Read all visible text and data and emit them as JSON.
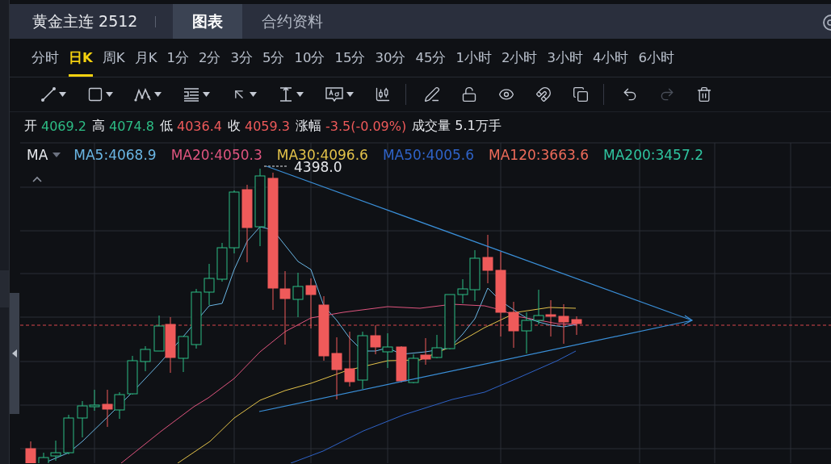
{
  "header": {
    "title": "黄金主连 2512",
    "tabs": [
      {
        "label": "图表",
        "selected": true
      },
      {
        "label": "合约资料",
        "selected": false
      }
    ]
  },
  "periods": [
    {
      "label": "分时",
      "selected": false
    },
    {
      "label": "日K",
      "selected": true
    },
    {
      "label": "周K",
      "selected": false
    },
    {
      "label": "月K",
      "selected": false
    },
    {
      "label": "1分",
      "selected": false
    },
    {
      "label": "2分",
      "selected": false
    },
    {
      "label": "3分",
      "selected": false
    },
    {
      "label": "5分",
      "selected": false
    },
    {
      "label": "10分",
      "selected": false
    },
    {
      "label": "15分",
      "selected": false
    },
    {
      "label": "30分",
      "selected": false
    },
    {
      "label": "45分",
      "selected": false
    },
    {
      "label": "1小时",
      "selected": false
    },
    {
      "label": "2小时",
      "selected": false
    },
    {
      "label": "3小时",
      "selected": false
    },
    {
      "label": "4小时",
      "selected": false
    },
    {
      "label": "6小时",
      "selected": false
    }
  ],
  "tools": [
    {
      "kind": "line",
      "dropdown": true,
      "disabled": false
    },
    {
      "kind": "rect",
      "dropdown": true,
      "disabled": false
    },
    {
      "kind": "pattern",
      "dropdown": true,
      "disabled": false
    },
    {
      "kind": "fib",
      "dropdown": true,
      "disabled": false
    },
    {
      "kind": "arrow",
      "dropdown": true,
      "disabled": false
    },
    {
      "kind": "measure",
      "dropdown": true,
      "disabled": false
    },
    {
      "kind": "text",
      "dropdown": true,
      "disabled": false
    },
    {
      "kind": "candles",
      "dropdown": false,
      "disabled": false
    },
    {
      "kind": "pencil",
      "dropdown": false,
      "disabled": false
    },
    {
      "kind": "lock",
      "dropdown": false,
      "disabled": false
    },
    {
      "kind": "eye",
      "dropdown": false,
      "disabled": false
    },
    {
      "kind": "magnet",
      "dropdown": false,
      "disabled": false
    },
    {
      "kind": "copy",
      "dropdown": false,
      "disabled": false
    },
    {
      "kind": "undo",
      "dropdown": false,
      "disabled": false
    },
    {
      "kind": "redo",
      "dropdown": false,
      "disabled": true
    },
    {
      "kind": "trash",
      "dropdown": false,
      "disabled": false
    }
  ],
  "quote": [
    {
      "label": "开",
      "value": "4069.2",
      "color": "#2dbd85"
    },
    {
      "label": "高",
      "value": "4074.8",
      "color": "#2dbd85"
    },
    {
      "label": "低",
      "value": "4036.4",
      "color": "#ef5a5a"
    },
    {
      "label": "收",
      "value": "4059.3",
      "color": "#ef5a5a"
    },
    {
      "label": "涨幅",
      "value": "-3.5(-0.09%)",
      "color": "#ef5a5a"
    },
    {
      "label": "成交量",
      "value": "5.1万手",
      "color": "#e6e8ec"
    }
  ],
  "ma": {
    "label": "MA",
    "lines": [
      {
        "text": "MA5:4068.9",
        "color": "#6ab6e4"
      },
      {
        "text": "MA20:4050.3",
        "color": "#e0557f"
      },
      {
        "text": "MA30:4096.6",
        "color": "#e3c24a"
      },
      {
        "text": "MA50:4005.6",
        "color": "#2f63c8"
      },
      {
        "text": "MA120:3663.6",
        "color": "#ee6b5a"
      },
      {
        "text": "MA200:3457.2",
        "color": "#2fc4a0"
      }
    ]
  },
  "chart": {
    "high_label": "4398.0"
  }
}
